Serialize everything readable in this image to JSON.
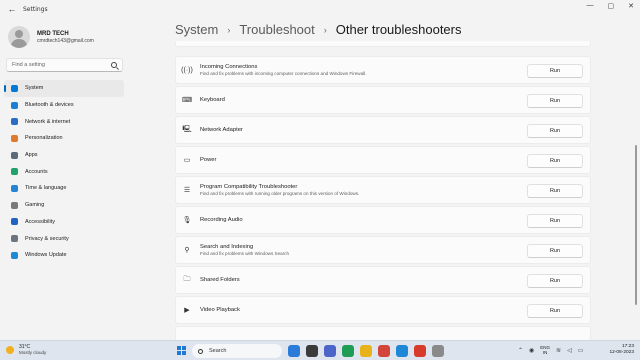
{
  "window": {
    "title": "Settings",
    "back_glyph": "←",
    "controls": [
      "—",
      "▢",
      "✕"
    ]
  },
  "profile": {
    "name": "MRD TECH",
    "email": "cmrdtech143@gmail.com"
  },
  "search": {
    "placeholder": "Find a setting"
  },
  "nav": [
    {
      "label": "System",
      "icon": "monitor-icon",
      "color": "#0078d4",
      "active": true
    },
    {
      "label": "Bluetooth & devices",
      "icon": "bluetooth-icon",
      "color": "#1b7fd6"
    },
    {
      "label": "Network & internet",
      "icon": "wifi-icon",
      "color": "#2b6cc4"
    },
    {
      "label": "Personalization",
      "icon": "brush-icon",
      "color": "#e07a2c"
    },
    {
      "label": "Apps",
      "icon": "apps-icon",
      "color": "#5c6b7a"
    },
    {
      "label": "Accounts",
      "icon": "person-icon",
      "color": "#1fa36b"
    },
    {
      "label": "Time & language",
      "icon": "globe-icon",
      "color": "#2584d6"
    },
    {
      "label": "Gaming",
      "icon": "gamepad-icon",
      "color": "#7a7a7a"
    },
    {
      "label": "Accessibility",
      "icon": "accessibility-icon",
      "color": "#1f63c4"
    },
    {
      "label": "Privacy & security",
      "icon": "shield-icon",
      "color": "#6b7580"
    },
    {
      "label": "Windows Update",
      "icon": "update-icon",
      "color": "#1e8ad6"
    }
  ],
  "breadcrumb": {
    "items": [
      "System",
      "Troubleshoot",
      "Other troubleshooters"
    ],
    "separator": "›"
  },
  "troubleshooters": [
    {
      "title": "Incoming Connections",
      "description": "Find and fix problems with incoming computer connections and Windows Firewall.",
      "icon": "broadcast-icon",
      "glyph": "((·))",
      "button": "Run"
    },
    {
      "title": "Keyboard",
      "description": "",
      "icon": "keyboard-icon",
      "glyph": "⌨",
      "button": "Run"
    },
    {
      "title": "Network Adapter",
      "description": "",
      "icon": "network-adapter-icon",
      "glyph": "🖳",
      "button": "Run"
    },
    {
      "title": "Power",
      "description": "",
      "icon": "battery-icon",
      "glyph": "▭",
      "button": "Run"
    },
    {
      "title": "Program Compatibility Troubleshooter",
      "description": "Find and fix problems with running older programs on this version of Windows.",
      "icon": "list-icon",
      "glyph": "☰",
      "button": "Run"
    },
    {
      "title": "Recording Audio",
      "description": "",
      "icon": "microphone-icon",
      "glyph": "🎙",
      "button": "Run"
    },
    {
      "title": "Search and Indexing",
      "description": "Find and fix problems with Windows Search",
      "icon": "search-icon",
      "glyph": "⚲",
      "button": "Run"
    },
    {
      "title": "Shared Folders",
      "description": "",
      "icon": "shared-folder-icon",
      "glyph": "🗀",
      "button": "Run"
    },
    {
      "title": "Video Playback",
      "description": "",
      "icon": "video-icon",
      "glyph": "▶",
      "button": "Run"
    }
  ],
  "taskbar": {
    "weather_temp": "31°C",
    "weather_desc": "Mostly cloudy",
    "search_label": "Search",
    "apps": [
      "#2b7bd8",
      "#3a3a3a",
      "#4b65c8",
      "#1f9d55",
      "#e8b21a",
      "#d3453a",
      "#1e88d6",
      "#d63b2b",
      "#8a8a8a"
    ],
    "lang_top": "ENG",
    "lang_bottom": "IN",
    "time": "17:23",
    "date": "12-08-2023"
  }
}
